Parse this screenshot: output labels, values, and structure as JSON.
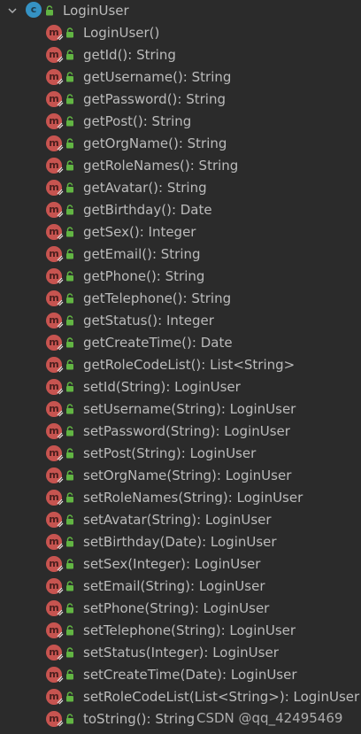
{
  "class_node": {
    "label": "LoginUser",
    "class_icon_letter": "c",
    "expand_icon": "chevron-down-icon",
    "class_icon": "class-icon",
    "access_icon": "public-lock-icon"
  },
  "method_icon_letter": "m",
  "method_icon": "method-icon",
  "access_icon": "public-lock-icon",
  "methods": [
    "LoginUser()",
    "getId(): String",
    "getUsername(): String",
    "getPassword(): String",
    "getPost(): String",
    "getOrgName(): String",
    "getRoleNames(): String",
    "getAvatar(): String",
    "getBirthday(): Date",
    "getSex(): Integer",
    "getEmail(): String",
    "getPhone(): String",
    "getTelephone(): String",
    "getStatus(): Integer",
    "getCreateTime(): Date",
    "getRoleCodeList(): List<String>",
    "setId(String): LoginUser",
    "setUsername(String): LoginUser",
    "setPassword(String): LoginUser",
    "setPost(String): LoginUser",
    "setOrgName(String): LoginUser",
    "setRoleNames(String): LoginUser",
    "setAvatar(String): LoginUser",
    "setBirthday(Date): LoginUser",
    "setSex(Integer): LoginUser",
    "setEmail(String): LoginUser",
    "setPhone(String): LoginUser",
    "setTelephone(String): LoginUser",
    "setStatus(Integer): LoginUser",
    "setCreateTime(Date): LoginUser",
    "setRoleCodeList(List<String>): LoginUser",
    "toString(): String"
  ],
  "watermark": "CSDN @qq_42495469",
  "colors": {
    "background": "#2b2b2b",
    "text": "#bbbbbb",
    "class_icon": "#3592c4",
    "method_icon": "#c75450",
    "lock": "#62b543"
  }
}
